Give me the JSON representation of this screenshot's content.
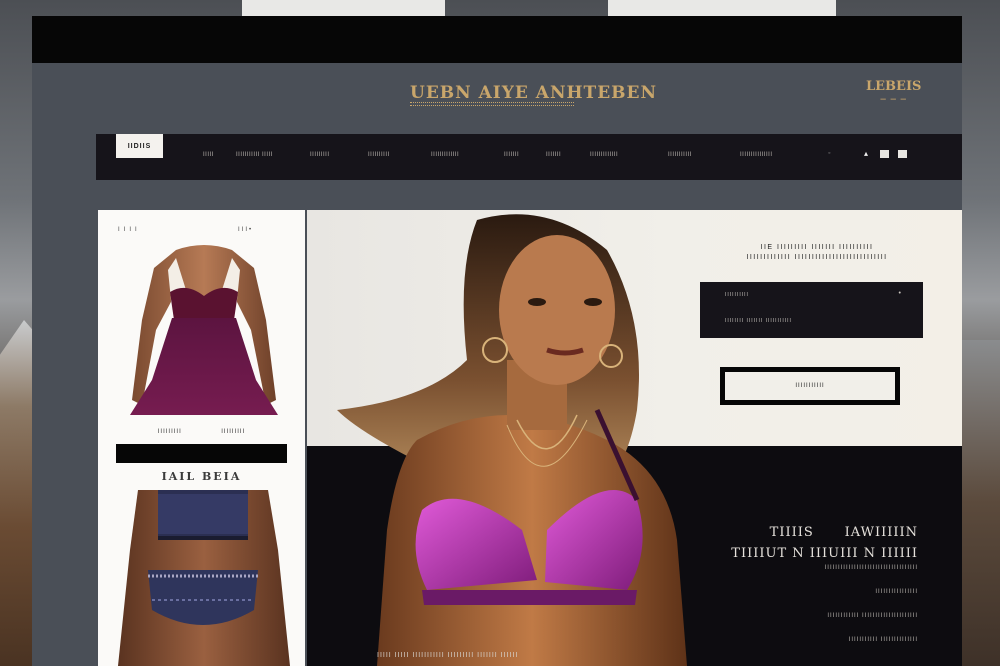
{
  "site": {
    "logo": "UEBN AIYE ANHTEBEN",
    "badge": "LEBEIS",
    "badge_sub": "— — —"
  },
  "nav": {
    "brand": "IIDIIS",
    "items": [
      "IIIII",
      "IIIIIIIIIII IIIII",
      "IIIIIIIII",
      "IIIIIIIIII",
      "IIIIIIIIIIIII",
      "IIIIIII",
      "IIIIIII",
      "IIIIIIIIIIIII",
      "IIIIIIIIIII",
      "IIIIIIIIIIIIIII"
    ]
  },
  "left_panel": {
    "top_label": "IIII",
    "top_dots": "III•",
    "captions": [
      "IIIIIIIII",
      "IIIIIIIII"
    ],
    "section_title": "IAIL BEIA"
  },
  "hero": {
    "heading_line1": "IIE IIIIIIIII IIIIIII IIIIIIIIII",
    "heading_line2": "IIIIIIIIIIIII IIIIIIIIIIIIIIIIIIIIIIIIIII",
    "card_line1": "IIIIIIIIII",
    "card_line2": "IIIIIIII IIIIIII IIIIIIIIIII",
    "cta_label": "IIIIIIIIIII",
    "lower_title": "TIIIIS      IAWIIIIIN\nTIIIIUT N IIIUIII N IIIIII",
    "lower_text": "IIIIIIIIIIIIIIIIIIIIIIIIIIIIIIIIIII\n\nIIIIIIIIIIIIIIII\n\nIIIIIIIIIIII IIIIIIIIIIIIIIIIIIIII\n\nIIIIIIIIIII IIIIIIIIIIIIII",
    "bottom_caption": "IIIII IIIII IIIIIIIIIII IIIIIIIII IIIIIII IIIIII"
  },
  "colors": {
    "accent_gold": "#c9a66b",
    "nav_bg": "#16141a",
    "swim_purple": "#a02a9c",
    "dress_purple": "#6a1947"
  }
}
